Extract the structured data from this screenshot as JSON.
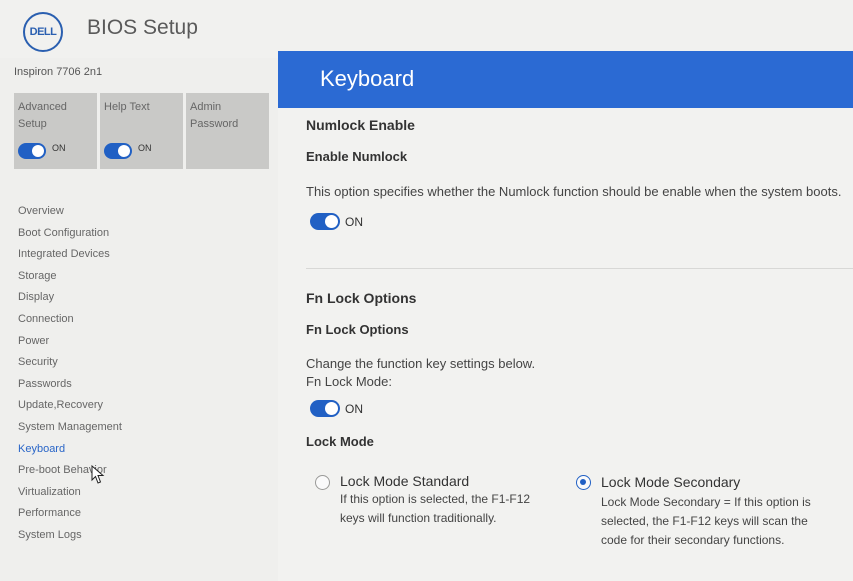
{
  "header": {
    "logo_text": "DELL",
    "title": "BIOS Setup"
  },
  "sidebar": {
    "model": "Inspiron 7706 2n1",
    "tiles": [
      {
        "label_line1": "Advanced",
        "label_line2": "Setup",
        "toggle_state": "ON"
      },
      {
        "label_line1": "Help Text",
        "label_line2": "",
        "toggle_state": "ON"
      },
      {
        "label_line1": "Admin",
        "label_line2": "Password",
        "toggle_state": ""
      }
    ],
    "nav": [
      "Overview",
      "Boot Configuration",
      "Integrated Devices",
      "Storage",
      "Display",
      "Connection",
      "Power",
      "Security",
      "Passwords",
      "Update,Recovery",
      "System Management",
      "Keyboard",
      "Pre-boot Behavior",
      "Virtualization",
      "Performance",
      "System Logs"
    ],
    "active_index": 11
  },
  "main": {
    "page_title": "Keyboard",
    "numlock": {
      "section_title": "Numlock Enable",
      "sub_title": "Enable Numlock",
      "description": "This option specifies whether the Numlock function should be enable when the system boots.",
      "toggle_state": "ON"
    },
    "fnlock": {
      "section_title": "Fn Lock Options",
      "sub_title": "Fn Lock Options",
      "description_line1": "Change the function key settings below.",
      "description_line2": "Fn Lock Mode:",
      "toggle_state": "ON",
      "lock_mode_title": "Lock Mode",
      "options": [
        {
          "title": "Lock Mode Standard",
          "desc_line1": "If this option is selected, the F1-F12",
          "desc_line2": "keys will function traditionally.",
          "desc_line3": "",
          "selected": false
        },
        {
          "title": "Lock Mode Secondary",
          "desc_line1": "Lock Mode Secondary = If this option is",
          "desc_line2": "selected, the F1-F12 keys will scan the",
          "desc_line3": "code for their secondary functions.",
          "selected": true
        }
      ]
    }
  },
  "colors": {
    "accent": "#2b6ad3",
    "toggle_on": "#2160c4",
    "active_nav": "#2a66c8"
  }
}
